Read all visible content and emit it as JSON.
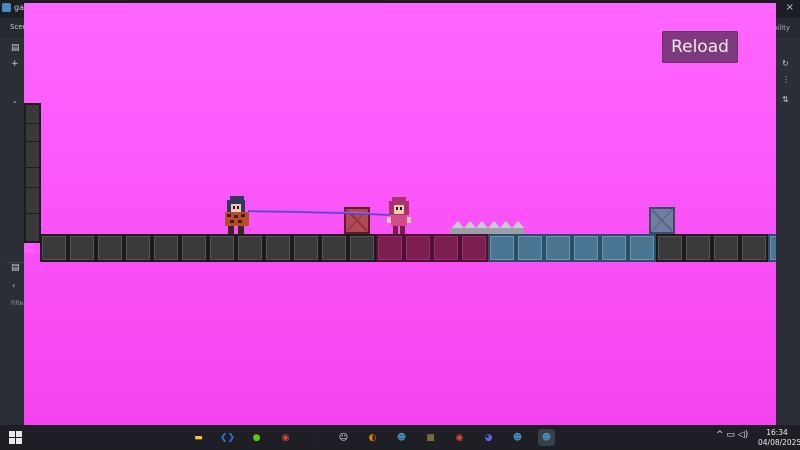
{
  "editor": {
    "title": "gam",
    "scene_menu": "Scene",
    "right_menu": "Compatibility",
    "filter_label": "Filte",
    "close_glyph": "×"
  },
  "game": {
    "reload_label": "Reload",
    "floor_tiles": [
      "dark",
      "dark",
      "dark",
      "dark",
      "dark",
      "dark",
      "dark",
      "dark",
      "dark",
      "dark",
      "dark",
      "dark",
      "red",
      "red",
      "red",
      "red",
      "blue",
      "blue",
      "blue",
      "blue",
      "blue",
      "blue",
      "dark",
      "dark",
      "dark",
      "dark",
      "blue"
    ]
  },
  "taskbar": {
    "apps": [
      {
        "name": "file-explorer-icon",
        "color": "#f5c242",
        "glyph": "▬"
      },
      {
        "name": "vscode-icon",
        "color": "#2b7bd6",
        "glyph": "❮❯"
      },
      {
        "name": "duolingo-icon",
        "color": "#58cc02",
        "glyph": "●"
      },
      {
        "name": "chrome-icon",
        "color": "#e04b3a",
        "glyph": "◉"
      },
      {
        "name": "obs-icon",
        "color": "#2a2a2a",
        "glyph": "◎"
      },
      {
        "name": "app-face-icon",
        "color": "#e9e9e9",
        "glyph": "☺"
      },
      {
        "name": "blender-icon",
        "color": "#ea7600",
        "glyph": "◐"
      },
      {
        "name": "godot-icon",
        "color": "#478cbf",
        "glyph": "☻"
      },
      {
        "name": "minecraft-icon",
        "color": "#7a6a3a",
        "glyph": "■"
      },
      {
        "name": "chrome-alt-icon",
        "color": "#e04b3a",
        "glyph": "◉"
      },
      {
        "name": "discord-icon",
        "color": "#5865f2",
        "glyph": "◕"
      },
      {
        "name": "godot-alt-icon",
        "color": "#478cbf",
        "glyph": "☻"
      },
      {
        "name": "godot-game-icon",
        "color": "#478cbf",
        "glyph": "☻"
      }
    ],
    "tray": "^  ▭ ◁)",
    "time": "16:34",
    "date": "04/08/2025"
  }
}
